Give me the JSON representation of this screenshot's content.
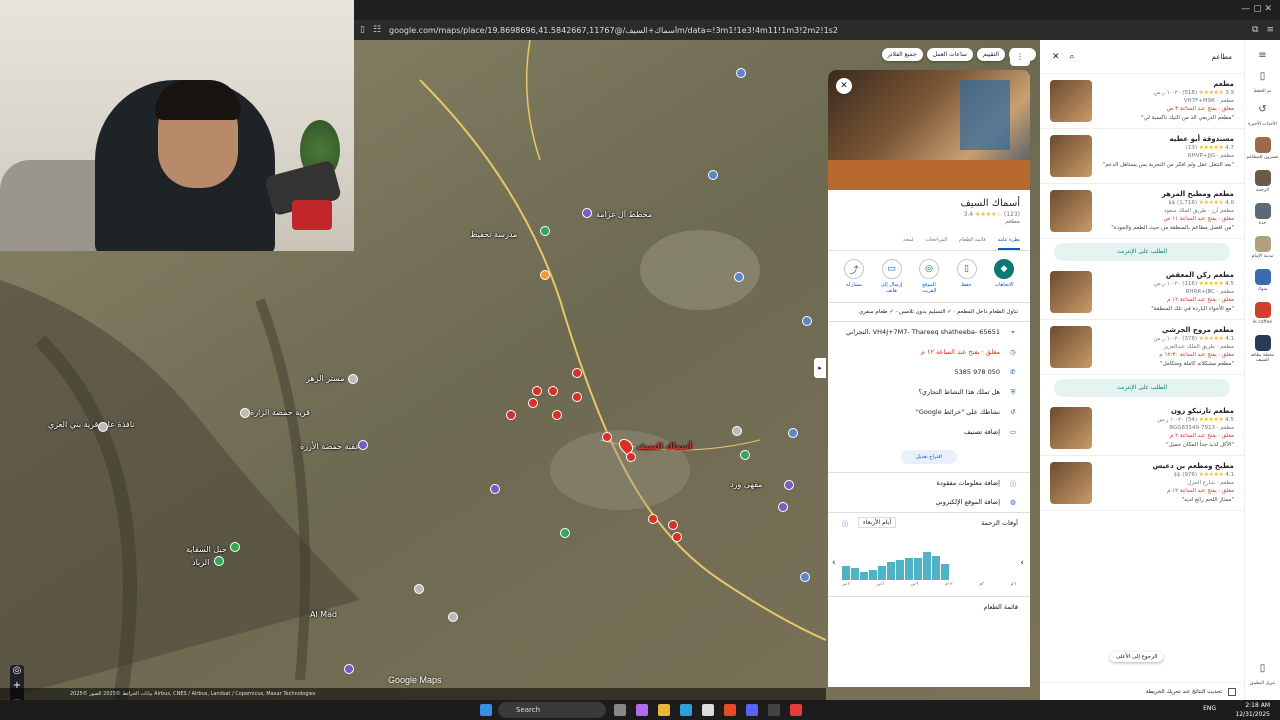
{
  "browser": {
    "url": "google.com/maps/place/أسماك+السيف/@19.8698696,41.5842667,11767m/data=!3m1!1e3!4m11!1m3!2m2!1s2"
  },
  "map": {
    "logo": "Google Maps",
    "attribution": "بيانات الخرائط ©2025 الصور ©2025 Airbus, CNES / Airbus, Landsat / Copernicus, Maxar Technologies",
    "labels": [
      {
        "text": "Al Mad"
      },
      {
        "text": "قرية حمضة الزارة"
      },
      {
        "text": "عقبة حمضة الأزرة"
      },
      {
        "text": "نافذة على قرية بني العزي"
      },
      {
        "text": "مستر الزهر"
      },
      {
        "text": "مدرسة تحفيظ"
      },
      {
        "text": "مقهى ورد"
      },
      {
        "text": "مخطط آل غرامة"
      },
      {
        "text": "جبل السقاية"
      },
      {
        "text": "الرباد"
      },
      {
        "text": "أسماك السيف"
      }
    ],
    "zoom_in": "+",
    "zoom_out": "−"
  },
  "chips": [
    "السعر",
    "التقييم",
    "ساعات العمل",
    "جميع الفلاتر"
  ],
  "place": {
    "name": "أسماك السيف",
    "rating": "3.4",
    "stars": "★★★★☆",
    "reviews": "(123)",
    "category": "مطعم",
    "tabs": [
      "نظرة عامة",
      "قائمة الطعام",
      "المراجعات",
      "لمحة"
    ],
    "actions": [
      "الاتجاهات",
      "حفظ",
      "الموقع القريب",
      "إرسال إلى هاتف",
      "مشاركة"
    ],
    "tags": "تناول الطعام داخل المطعم · ✓ التسليم بدون تلامس · ✓ طعام سفري",
    "address": "VH4J+7M7- Thareeq shatheeba- 65651 ،النجراني",
    "hours": "مغلق · يفتح عند الساعة ١٢ م",
    "phone": "050 978 5385",
    "claim": "هل تملك هذا النشاط التجاري؟",
    "history": "نشاطك على \"خرائط Google\"",
    "label": "إضافة تصنيف",
    "suggest": "اقتراح تعديل",
    "missing": "إضافة معلومات مفقودة",
    "website": "إضافة الموقع الإلكتروني",
    "popular": "أوقات الزحمة",
    "day": "أيام الأربعاء",
    "menu": "قائمة الطعام"
  },
  "popular_times": {
    "values": [
      0.35,
      0.3,
      0.2,
      0.25,
      0.35,
      0.45,
      0.5,
      0.55,
      0.55,
      0.7,
      0.6,
      0.4
    ],
    "hours": [
      "٣ص",
      "٦ص",
      "٩ص",
      "١٢م",
      "٣م",
      "٦م"
    ]
  },
  "search": {
    "query": "مطاعم"
  },
  "results": [
    {
      "name": "مطعم",
      "rating": "3.9",
      "reviews": "(518)",
      "price": "٢٠-١٠ ر.س",
      "meta": "مطعم · VH7F+M9R",
      "status": "مغلق · يفتح عند الساعة ٣ ص",
      "review": "\"مطعم الدريعي الذ من التيك ناكسبة لي\""
    },
    {
      "name": "مسندوقة أبو عطيه",
      "rating": "4.7",
      "reviews": "(13)",
      "price": "",
      "meta": "مطعم · RHVP+JJG",
      "status": "",
      "review": "\"بعد التتقل عقل ولم افكر من التجربة بس يستاهل الدعم\""
    },
    {
      "name": "مطعم ومطبخ المزهر",
      "rating": "4.0",
      "reviews": "(1,716)",
      "price": "$$",
      "meta": "مطعم أرز · طريق الملك سعود",
      "status": "مغلق · يفتح عند الساعة ١١ ص",
      "review": "\"من افضل مطاعم بالمنطقة من حيث الطعم والجودة\"",
      "order": "الطلب على الإنترنت"
    },
    {
      "name": "مطعم ركن المعقص",
      "rating": "4.5",
      "reviews": "(116)",
      "price": "٢٠-١٠ ر.س",
      "meta": "مطعم · RHRR+JBC",
      "status": "مغلق · يفتح عند الساعة ١٢ م",
      "review": "\"مع الأجواء الباردة في تلك المنطقة\""
    },
    {
      "name": "مطعم مروج الجرشي",
      "rating": "4.1",
      "reviews": "(378)",
      "price": "٢٠-١٠ ر.س",
      "meta": "مطعم · طريق الملك عبدالعزيز",
      "status": "مغلق · يفتح عند الساعة ١٢:٣٠ م",
      "review": "\"مطعم مشكلاته كاملة ومتكامل\"",
      "order": "الطلب على الإنترنت"
    },
    {
      "name": "مطعم تارتيكو زون",
      "rating": "4.5",
      "reviews": "(54)",
      "price": "٢٠-١٠ ر.س",
      "meta": "مطعم · BGG83549-7913",
      "status": "مغلق · يفتح عند الساعة ٢ م",
      "review": "\"الأكل لذيذ جداً المكان جميل\""
    },
    {
      "name": "مطبخ ومطعم بن دعيس",
      "rating": "4.1",
      "reviews": "(976)",
      "price": "$$",
      "meta": "مطعم · شارع الجزل",
      "status": "مغلق · يفتح عند الساعة ١٢ م",
      "review": "\"ممتاز اللحم رائع لديه\""
    }
  ],
  "results_footer": "تحديث النتائج عند تحريك الخريطة",
  "back_to_top": "الرجوع إلى الأعلى",
  "rail": [
    "تم الحفظ",
    "الأحداث الأخيرة",
    "عشرون للمطاعم",
    "الزحمة",
    "جدة",
    "مدينة الإمام",
    "شوك",
    "ik coffee",
    "محطة بطاقة السيف",
    "تنزيل التطبيق"
  ],
  "taskbar": {
    "search": "Search",
    "lang": "ENG",
    "time": "2:18 AM",
    "date": "12/31/2025"
  }
}
